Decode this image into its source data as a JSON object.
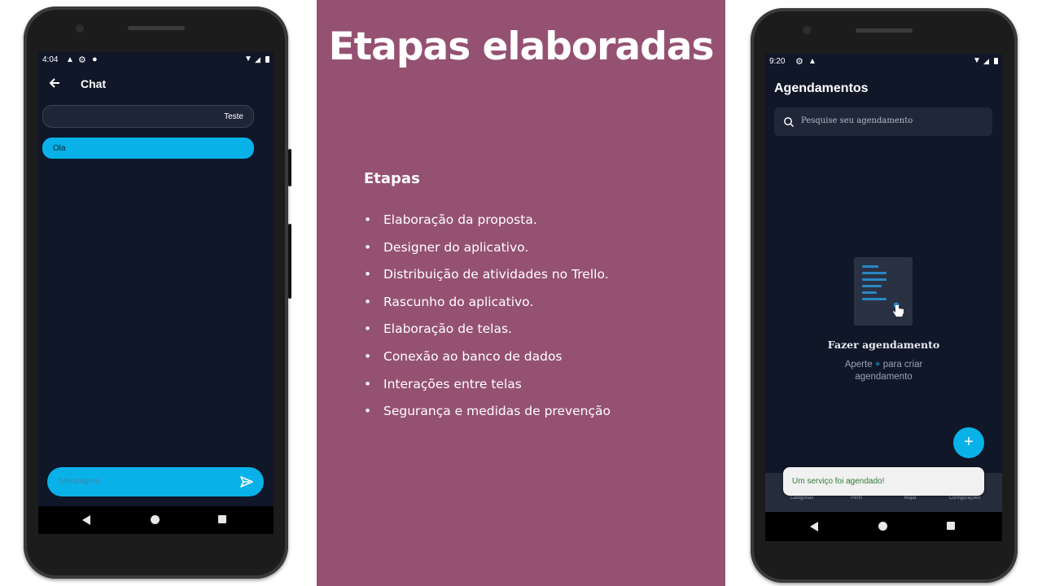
{
  "slide": {
    "title": "Etapas elaboradas",
    "section_heading": "Etapas",
    "steps": [
      "Elaboração da proposta.",
      "Designer do aplicativo.",
      "Distribuição de atividades no Trello.",
      "Rascunho do aplicativo.",
      "Elaboração de telas.",
      "Conexão ao banco de dados",
      "Interações entre telas",
      "Segurança e medidas de prevenção"
    ],
    "panel_color": "#955172"
  },
  "chat_phone": {
    "status": {
      "time": "4:04"
    },
    "app_bar": {
      "back_icon": "arrow-left-icon",
      "title": "Chat"
    },
    "messages": [
      {
        "text": "Teste",
        "direction": "outgoing"
      },
      {
        "text": "Ola",
        "direction": "incoming"
      }
    ],
    "input": {
      "placeholder": "Mensagem",
      "send_icon": "send-icon"
    },
    "accent": "#08b2e8"
  },
  "agenda_phone": {
    "status": {
      "time": "9:20"
    },
    "title": "Agendamentos",
    "search": {
      "placeholder": "Pesquise seu agendamento",
      "icon": "search-icon"
    },
    "empty_state": {
      "title": "Fazer agendamento",
      "subtitle_before": "Aperte",
      "subtitle_plus": "+",
      "subtitle_after": "para criar",
      "subtitle_line2": "agendamento"
    },
    "fab_label": "+",
    "bottom_nav": [
      "Categorias",
      "Perfil",
      "Mapa",
      "Configurações"
    ],
    "toast": "Um serviço foi agendado!",
    "accent": "#08b2e8"
  }
}
